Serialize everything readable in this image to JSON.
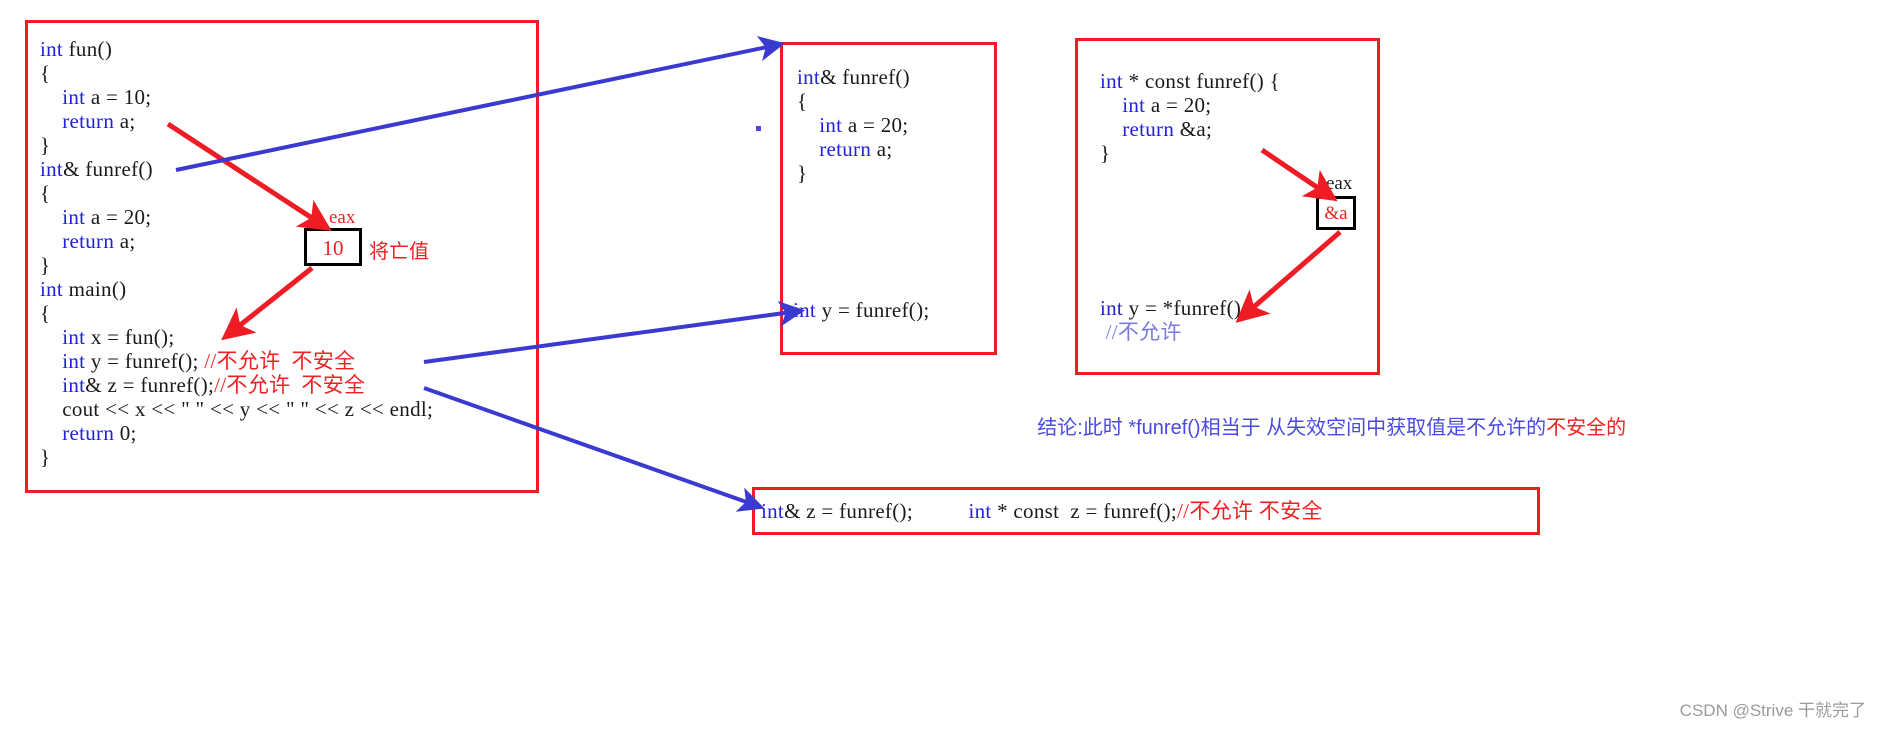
{
  "diagram": {
    "title": "C++ returning reference vs pointer to local variable",
    "watermark": "CSDN @Strive 干就完了",
    "colors": {
      "box_border": "#ee1c25",
      "keyword": "#2222dd",
      "comment_red": "#ee2222",
      "comment_blue": "#7b7bdd",
      "arrow_red": "#ee1c25",
      "arrow_blue": "#3a3ad0",
      "register_border": "#000000",
      "conclusion_text": "#4a4ae0"
    }
  },
  "left_box": {
    "name": "main-program-code",
    "lines": [
      {
        "kw": "int",
        "rest": " fun()"
      },
      {
        "kw": "",
        "rest": "{"
      },
      {
        "kw": "    int",
        "rest": " a = 10;"
      },
      {
        "kw": "    return",
        "rest": " a;"
      },
      {
        "kw": "",
        "rest": "}"
      },
      {
        "kw": "int",
        "rest": "& funref()"
      },
      {
        "kw": "",
        "rest": "{"
      },
      {
        "kw": "    int",
        "rest": " a = 20;"
      },
      {
        "kw": "    return",
        "rest": " a;"
      },
      {
        "kw": "",
        "rest": "}"
      },
      {
        "kw": "int",
        "rest": " main()"
      },
      {
        "kw": "",
        "rest": "{"
      },
      {
        "kw": "    int",
        "rest": " x = fun();"
      },
      {
        "kw": "    int",
        "rest": " y = funref(); ",
        "comment": "//不允许  不安全"
      },
      {
        "kw": "    int",
        "rest": "& z = funref();",
        "comment": "//不允许  不安全"
      },
      {
        "kw": "",
        "rest": "    cout << x << \" \" << y << \" \" << z << endl;"
      },
      {
        "kw": "    return",
        "rest": " 0;"
      },
      {
        "kw": "",
        "rest": "}"
      }
    ]
  },
  "middle_box": {
    "name": "funref-reference-version",
    "top_lines": [
      {
        "kw": "int",
        "rest": "& funref()"
      },
      {
        "kw": "",
        "rest": "{"
      },
      {
        "kw": "    int",
        "rest": " a = 20;"
      },
      {
        "kw": "    return",
        "rest": " a;"
      },
      {
        "kw": "",
        "rest": "}"
      }
    ],
    "bottom_lines": [
      {
        "kw": "int",
        "rest": " y = funref();"
      }
    ]
  },
  "right_box": {
    "name": "funref-pointer-version",
    "top_lines": [
      {
        "kw": "int",
        "rest": " * const funref() {"
      },
      {
        "kw": "    int",
        "rest": " a = 20;"
      },
      {
        "kw": "    return",
        "rest": " &a;"
      },
      {
        "kw": "",
        "rest": "}"
      }
    ],
    "bottom_lines": [
      {
        "kw": "int",
        "rest": " y = *funref();"
      },
      {
        "kw": "",
        "rest": " ",
        "comment_blue": "//不允许"
      }
    ]
  },
  "bottom_box": {
    "name": "comparison-strip",
    "left_code": {
      "kw": "int",
      "rest": "& z = funref();"
    },
    "right_code": {
      "kw": "int",
      "rest": " * const  z = funref();"
    },
    "right_comment": "//不允许 不安全"
  },
  "annotations": {
    "eax_label_left": "eax",
    "eax_value_left": "10",
    "eax_label_right": "eax",
    "eax_value_right": "&a",
    "dying_value_label": "将亡值",
    "conclusion_prefix": "结论:此时 *funref()相当于 从失效空间中获取值是不允许的",
    "conclusion_highlight": "不安全的"
  }
}
